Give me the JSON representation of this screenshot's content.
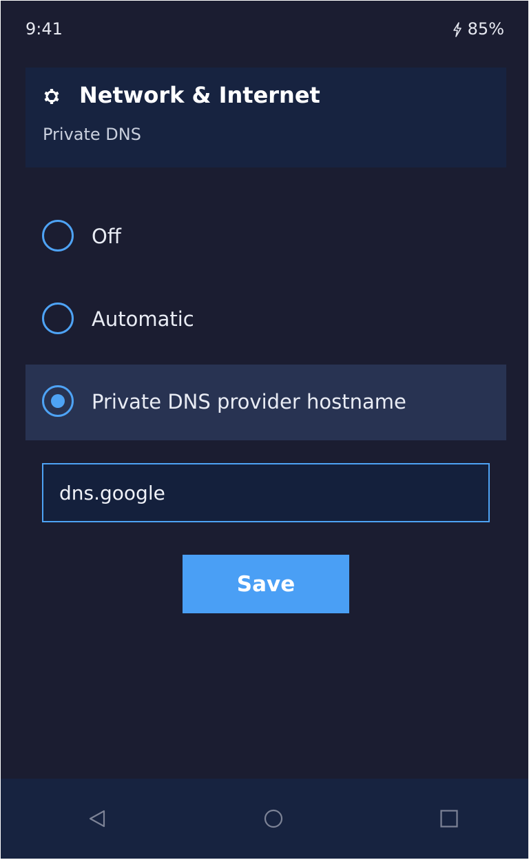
{
  "status_bar": {
    "time": "9:41",
    "battery": "85%",
    "battery_icon": "bolt-icon"
  },
  "header": {
    "icon": "gear-icon",
    "title": "Network & Internet",
    "subtitle": "Private DNS"
  },
  "dns_options": [
    {
      "label": "Off",
      "selected": false
    },
    {
      "label": "Automatic",
      "selected": false
    },
    {
      "label": "Private DNS provider hostname",
      "selected": true
    }
  ],
  "hostname_input": {
    "value": "dns.google"
  },
  "save_button": {
    "label": "Save"
  },
  "nav_bar": {
    "back_icon": "back-triangle-icon",
    "home_icon": "home-circle-icon",
    "recents_icon": "recents-square-icon"
  },
  "colors": {
    "background": "#1b1d31",
    "card": "#172340",
    "selected_row": "#283352",
    "accent": "#4ea3f5"
  }
}
